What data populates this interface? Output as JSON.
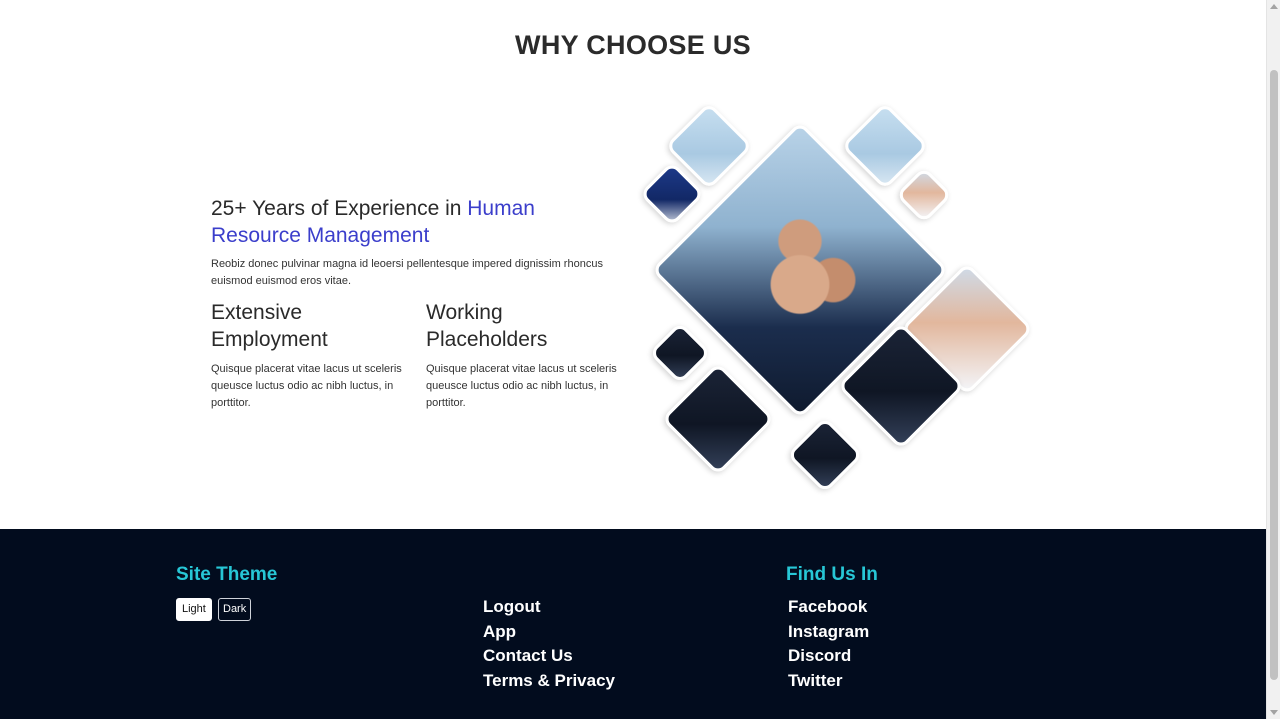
{
  "section": {
    "title": "WHY CHOOSE US"
  },
  "content": {
    "headline_plain": "25+ Years of Experience in ",
    "headline_accent": "Human Resource Management",
    "intro": "Reobiz donec pulvinar magna id leoersi pellentesque impered dignissim rhoncus euismod euismod eros vitae.",
    "features": [
      {
        "title": "Extensive Employment",
        "text": "Quisque placerat vitae lacus ut sceleris queusce luctus odio ac nibh luctus, in porttitor."
      },
      {
        "title": "Working Placeholders",
        "text": "Quisque placerat vitae lacus ut sceleris queusce luctus odio ac nibh luctus, in porttitor."
      }
    ]
  },
  "collage": {
    "icon": "team-fist-bump-photo-collage"
  },
  "footer": {
    "theme_heading": "Site Theme",
    "theme_light": "Light",
    "theme_dark": "Dark",
    "links": [
      "Logout",
      "App",
      "Contact Us",
      "Terms & Privacy"
    ],
    "find_heading": "Find Us In",
    "social": [
      "Facebook",
      "Instagram",
      "Discord",
      "Twitter"
    ]
  },
  "colors": {
    "accent": "#3b3ecb",
    "footer_bg": "#020c1e",
    "footer_heading": "#27c7d6"
  }
}
